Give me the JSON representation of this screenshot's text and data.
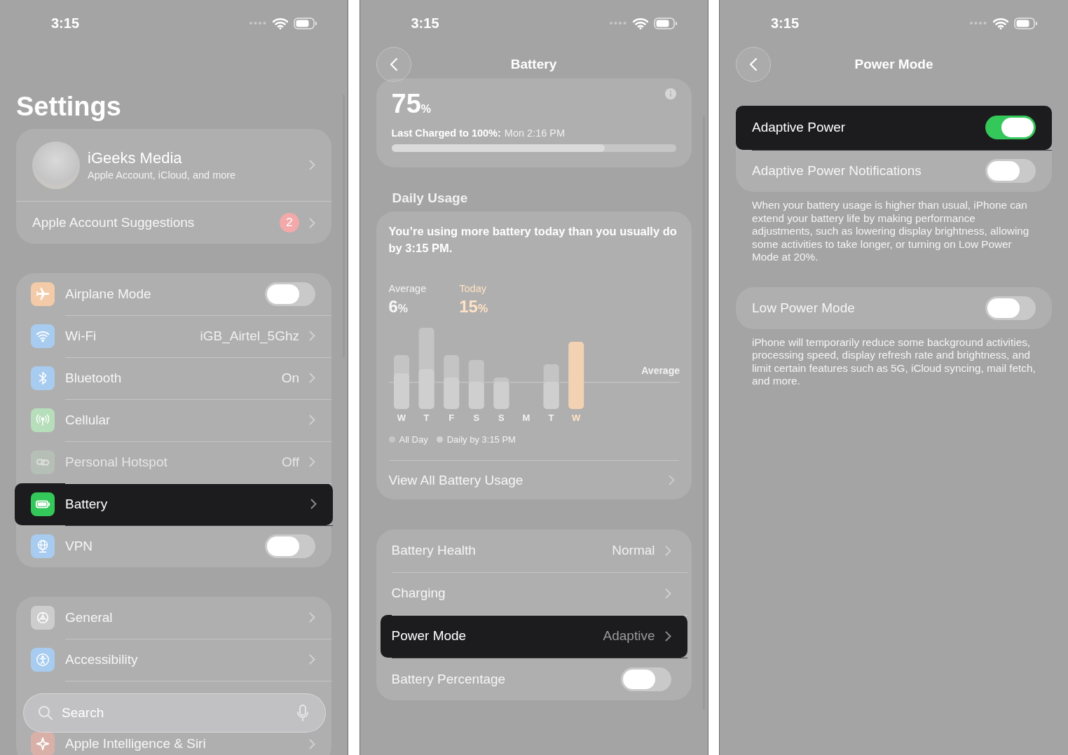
{
  "settings_screen": {
    "status_time": "3:15",
    "title": "Settings",
    "profile": {
      "name": "iGeeks Media",
      "subtitle": "Apple Account, iCloud, and more"
    },
    "suggestions": {
      "label": "Apple Account Suggestions",
      "badge": "2"
    },
    "groups": [
      {
        "rows": [
          {
            "label": "Airplane Mode",
            "kind": "toggle",
            "on": false,
            "selected": false,
            "disabled": false
          },
          {
            "label": "Wi-Fi",
            "kind": "link",
            "value": "iGB_Airtel_5Ghz",
            "selected": false,
            "disabled": false
          },
          {
            "label": "Bluetooth",
            "kind": "link",
            "value": "On",
            "selected": false,
            "disabled": false
          },
          {
            "label": "Cellular",
            "kind": "link",
            "selected": false,
            "disabled": false
          },
          {
            "label": "Personal Hotspot",
            "kind": "link",
            "value": "Off",
            "selected": false,
            "disabled": true
          },
          {
            "label": "Battery",
            "kind": "link",
            "selected": true,
            "disabled": false
          },
          {
            "label": "VPN",
            "kind": "toggle",
            "on": false,
            "selected": false,
            "disabled": false
          }
        ]
      },
      {
        "rows": [
          {
            "label": "General",
            "kind": "link",
            "selected": false,
            "disabled": false
          },
          {
            "label": "Accessibility",
            "kind": "link",
            "selected": false,
            "disabled": false
          },
          {
            "label": "Apple Intelligence & Siri",
            "kind": "link",
            "selected": false,
            "disabled": false
          }
        ]
      }
    ],
    "search": {
      "placeholder": "Search"
    }
  },
  "battery_screen": {
    "status_time": "3:15",
    "title": "Battery",
    "charge": {
      "value": "75",
      "unit": "%",
      "level": 0.75
    },
    "last_charged_label": "Last Charged to 100%:",
    "last_charged_value": "Mon 2:16 PM",
    "section_header": "Daily Usage",
    "message": "You’re using more battery today than you usually do by 3:15 PM.",
    "stats": [
      {
        "label": "Average",
        "value": "6",
        "unit": "%",
        "highlighted": false
      },
      {
        "label": "Today",
        "value": "15",
        "unit": "%",
        "highlighted": true
      }
    ],
    "days": [
      {
        "label": "W",
        "selected": false
      },
      {
        "label": "T",
        "selected": false
      },
      {
        "label": "F",
        "selected": false
      },
      {
        "label": "S",
        "selected": false
      },
      {
        "label": "S",
        "selected": false
      },
      {
        "label": "M",
        "selected": false
      },
      {
        "label": "T",
        "selected": false
      },
      {
        "label": "W",
        "selected": true
      }
    ],
    "average_label": "Average",
    "legend": [
      "All Day",
      "Daily by 3:15 PM"
    ],
    "view_all": "View All Battery Usage",
    "rows": [
      {
        "label": "Battery Health",
        "kind": "link",
        "value": "Normal",
        "selected": false
      },
      {
        "label": "Charging",
        "kind": "link",
        "selected": false
      },
      {
        "label": "Power Mode",
        "kind": "link",
        "value": "Adaptive",
        "selected": true
      },
      {
        "label": "Battery Percentage",
        "kind": "toggle",
        "on": false,
        "selected": false
      }
    ]
  },
  "power_mode_screen": {
    "status_time": "3:15",
    "title": "Power Mode",
    "groups": [
      {
        "rows": [
          {
            "label": "Adaptive Power",
            "kind": "toggle",
            "on": true,
            "selected": true
          },
          {
            "label": "Adaptive Power Notifications",
            "kind": "toggle",
            "on": false,
            "selected": false
          }
        ],
        "footer": "When your battery usage is higher than usual, iPhone can extend your battery life by making performance adjustments, such as lowering display brightness, allowing some activities to take longer, or turning on Low Power Mode at 20%."
      },
      {
        "rows": [
          {
            "label": "Low Power Mode",
            "kind": "toggle",
            "on": false,
            "selected": false
          }
        ],
        "footer": "iPhone will temporarily reduce some background activities, processing speed, display refresh rate and brightness, and limit certain features such as 5G, iCloud syncing, mail fetch, and more."
      }
    ]
  }
}
